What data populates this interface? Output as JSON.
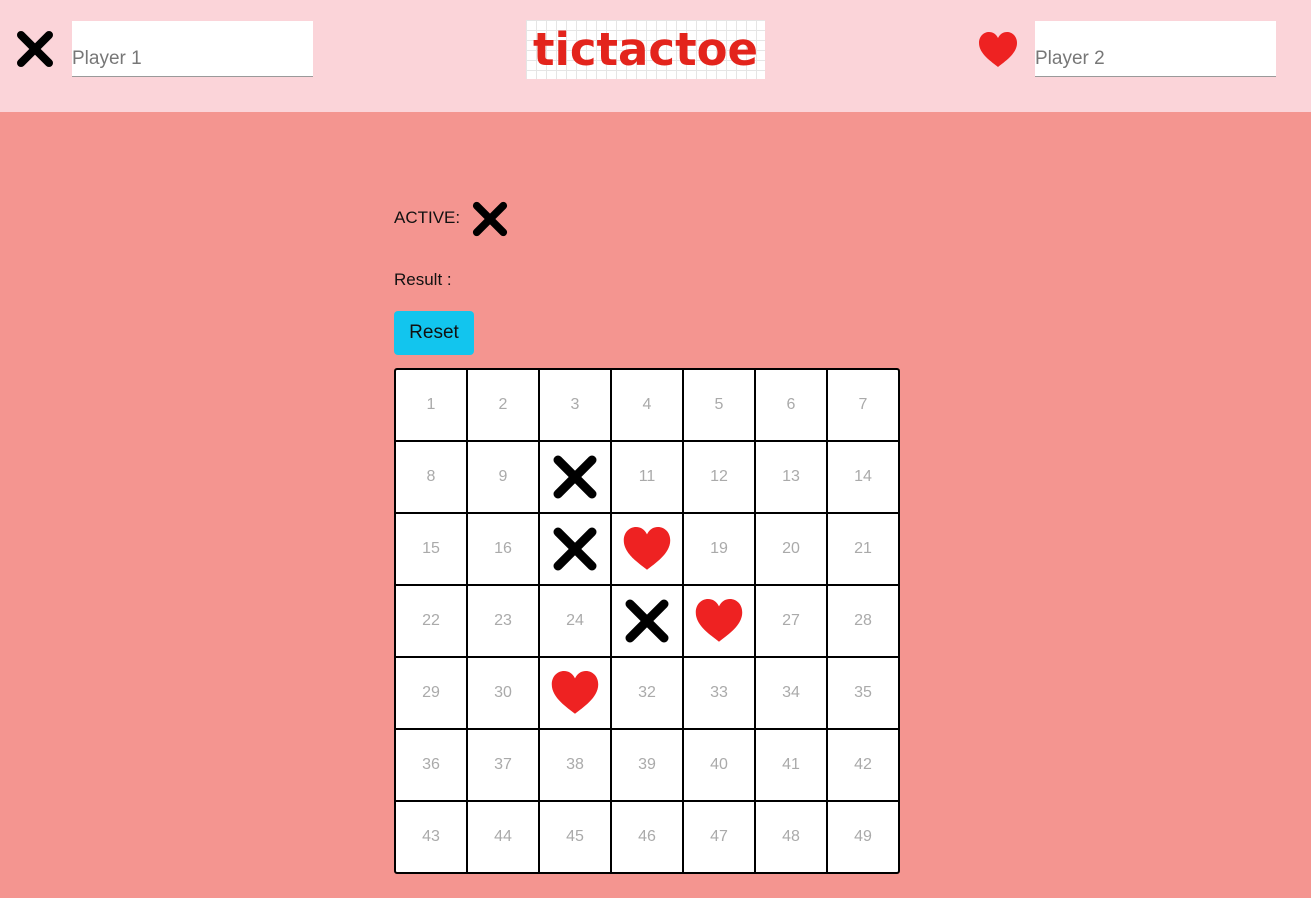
{
  "header": {
    "logo_text": "tictactoe",
    "player1": {
      "icon": "x-mark-icon",
      "placeholder": "Player 1",
      "value": ""
    },
    "player2": {
      "icon": "heart-icon",
      "placeholder": "Player 2",
      "value": ""
    }
  },
  "status": {
    "active_label": "ACTIVE:",
    "active_player": "x",
    "result_label": "Result :",
    "result_value": ""
  },
  "controls": {
    "reset_label": "Reset"
  },
  "board": {
    "size": 7,
    "cells": [
      "1",
      "2",
      "3",
      "4",
      "5",
      "6",
      "7",
      "8",
      "9",
      "X",
      "11",
      "12",
      "13",
      "14",
      "15",
      "16",
      "X",
      "O",
      "19",
      "20",
      "21",
      "22",
      "23",
      "24",
      "X",
      "O",
      "27",
      "28",
      "29",
      "30",
      "O",
      "32",
      "33",
      "34",
      "35",
      "36",
      "37",
      "38",
      "39",
      "40",
      "41",
      "42",
      "43",
      "44",
      "45",
      "46",
      "47",
      "48",
      "49"
    ]
  },
  "colors": {
    "header_bg": "#fbd4d9",
    "page_bg": "#f49590",
    "accent_red": "#e3241c",
    "reset_bg": "#12c5ee",
    "x_mark": "#000000",
    "heart": "#ee2222"
  }
}
